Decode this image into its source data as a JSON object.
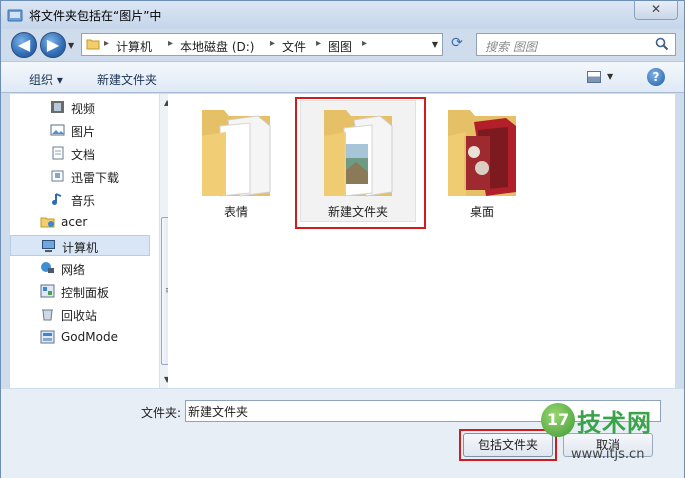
{
  "window": {
    "title": "将文件夹包括在“图片”中",
    "close_label": "✕"
  },
  "nav": {
    "back_glyph": "◀",
    "forward_glyph": "▶",
    "breadcrumbs": [
      "计算机",
      "本地磁盘 (D:)",
      "文件",
      "图图"
    ],
    "search_placeholder": "搜索 图图"
  },
  "toolbar": {
    "organize_label": "组织 ▾",
    "new_folder_label": "新建文件夹",
    "help_label": "?"
  },
  "sidebar": {
    "items": [
      {
        "label": "视频",
        "icon": "video-library-icon"
      },
      {
        "label": "图片",
        "icon": "pictures-library-icon"
      },
      {
        "label": "文档",
        "icon": "documents-library-icon"
      },
      {
        "label": "迅雷下载",
        "icon": "download-folder-icon"
      },
      {
        "label": "音乐",
        "icon": "music-library-icon"
      },
      {
        "label": "acer",
        "icon": "user-folder-icon"
      },
      {
        "label": "计算机",
        "icon": "computer-icon"
      },
      {
        "label": "网络",
        "icon": "network-icon"
      },
      {
        "label": "控制面板",
        "icon": "control-panel-icon"
      },
      {
        "label": "回收站",
        "icon": "recycle-bin-icon"
      },
      {
        "label": "GodMode",
        "icon": "godmode-icon"
      }
    ],
    "selected": "计算机"
  },
  "content": {
    "folders": [
      {
        "label": "表情",
        "icon": "folder-icon"
      },
      {
        "label": "新建文件夹",
        "icon": "folder-icon"
      },
      {
        "label": "桌面",
        "icon": "folder-icon"
      }
    ],
    "selected": "新建文件夹"
  },
  "footer": {
    "folder_label": "文件夹:",
    "folder_value": "新建文件夹",
    "include_button": "包括文件夹",
    "cancel_button": "取消"
  },
  "watermark": {
    "badge": "17",
    "text": "技术网",
    "url": "www.itjs.cn"
  },
  "colors": {
    "highlight_box": "#d01c1c",
    "accent": "#2f6db5"
  }
}
